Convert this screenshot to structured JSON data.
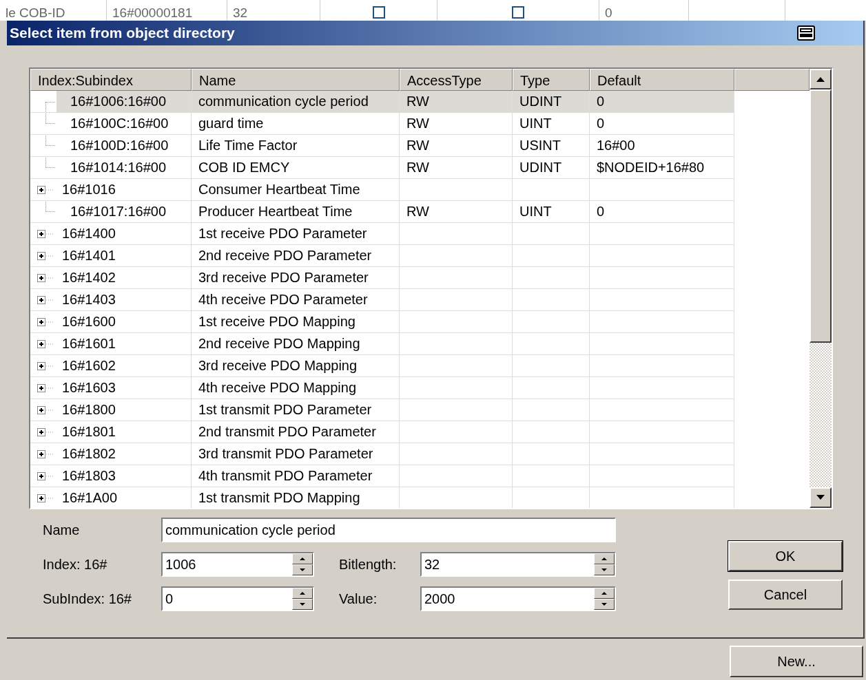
{
  "background_row": {
    "cells": [
      {
        "kind": "text",
        "text": "le COB-ID"
      },
      {
        "kind": "text",
        "text": "16#00000181"
      },
      {
        "kind": "text",
        "text": "32"
      },
      {
        "kind": "checkbox",
        "checked": false
      },
      {
        "kind": "checkbox",
        "checked": false
      },
      {
        "kind": "text",
        "text": "0"
      }
    ]
  },
  "window": {
    "title": "Select item from object directory"
  },
  "table": {
    "columns": [
      "Index:Subindex",
      "Name",
      "AccessType",
      "Type",
      "Default"
    ],
    "rows": [
      {
        "kind": "leaf",
        "selected": true,
        "cells": [
          "16#1006:16#00",
          "communication cycle period",
          "RW",
          "UDINT",
          "0"
        ]
      },
      {
        "kind": "leaf",
        "selected": false,
        "cells": [
          "16#100C:16#00",
          "guard time",
          "RW",
          "UINT",
          "0"
        ]
      },
      {
        "kind": "leaf",
        "selected": false,
        "cells": [
          "16#100D:16#00",
          "Life Time Factor",
          "RW",
          "USINT",
          "16#00"
        ]
      },
      {
        "kind": "leaf",
        "selected": false,
        "cells": [
          "16#1014:16#00",
          "COB ID EMCY",
          "RW",
          "UDINT",
          "$NODEID+16#80"
        ]
      },
      {
        "kind": "group",
        "expanded": false,
        "selected": false,
        "cells": [
          "16#1016",
          "Consumer Heartbeat Time",
          "",
          "",
          ""
        ]
      },
      {
        "kind": "leaf",
        "selected": false,
        "cells": [
          "16#1017:16#00",
          "Producer Heartbeat Time",
          "RW",
          "UINT",
          "0"
        ]
      },
      {
        "kind": "group",
        "expanded": false,
        "selected": false,
        "cells": [
          "16#1400",
          "1st receive PDO Parameter",
          "",
          "",
          ""
        ]
      },
      {
        "kind": "group",
        "expanded": false,
        "selected": false,
        "cells": [
          "16#1401",
          "2nd receive PDO Parameter",
          "",
          "",
          ""
        ]
      },
      {
        "kind": "group",
        "expanded": false,
        "selected": false,
        "cells": [
          "16#1402",
          "3rd receive PDO Parameter",
          "",
          "",
          ""
        ]
      },
      {
        "kind": "group",
        "expanded": false,
        "selected": false,
        "cells": [
          "16#1403",
          "4th receive PDO Parameter",
          "",
          "",
          ""
        ]
      },
      {
        "kind": "group",
        "expanded": false,
        "selected": false,
        "cells": [
          "16#1600",
          "1st receive PDO Mapping",
          "",
          "",
          ""
        ]
      },
      {
        "kind": "group",
        "expanded": false,
        "selected": false,
        "cells": [
          "16#1601",
          "2nd receive PDO Mapping",
          "",
          "",
          ""
        ]
      },
      {
        "kind": "group",
        "expanded": false,
        "selected": false,
        "cells": [
          "16#1602",
          "3rd receive PDO Mapping",
          "",
          "",
          ""
        ]
      },
      {
        "kind": "group",
        "expanded": false,
        "selected": false,
        "cells": [
          "16#1603",
          "4th receive PDO Mapping",
          "",
          "",
          ""
        ]
      },
      {
        "kind": "group",
        "expanded": false,
        "selected": false,
        "cells": [
          "16#1800",
          "1st transmit PDO Parameter",
          "",
          "",
          ""
        ]
      },
      {
        "kind": "group",
        "expanded": false,
        "selected": false,
        "cells": [
          "16#1801",
          "2nd transmit PDO Parameter",
          "",
          "",
          ""
        ]
      },
      {
        "kind": "group",
        "expanded": false,
        "selected": false,
        "cells": [
          "16#1802",
          "3rd transmit PDO Parameter",
          "",
          "",
          ""
        ]
      },
      {
        "kind": "group",
        "expanded": false,
        "selected": false,
        "cells": [
          "16#1803",
          "4th transmit PDO Parameter",
          "",
          "",
          ""
        ]
      },
      {
        "kind": "group",
        "expanded": false,
        "selected": false,
        "cells": [
          "16#1A00",
          "1st transmit PDO Mapping",
          "",
          "",
          ""
        ]
      }
    ]
  },
  "form": {
    "name": {
      "label": "Name",
      "value": "communication cycle period"
    },
    "index": {
      "label": "Index:  16#",
      "value": "1006"
    },
    "bitlength": {
      "label": "Bitlength:",
      "value": "32"
    },
    "subindex": {
      "label": "SubIndex: 16#",
      "value": "0"
    },
    "value": {
      "label": "Value:",
      "value": "2000"
    }
  },
  "buttons": [
    "OK",
    "Cancel"
  ],
  "outer_button": "New..."
}
